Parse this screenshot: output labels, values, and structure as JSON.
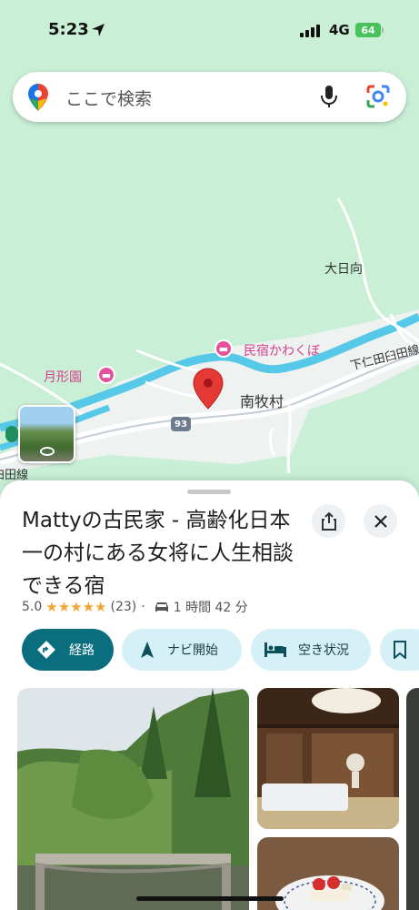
{
  "status_bar": {
    "time": "5:23",
    "network": "4G",
    "battery": "64"
  },
  "search": {
    "placeholder": "ここで検索"
  },
  "map": {
    "labels": {
      "ohinata": "大日向",
      "minamimaki": "南牧村",
      "shimonita_line_right": "下仁田臼田線",
      "usuda_line_left": "臼田線",
      "route_number": "93"
    },
    "pois": {
      "kawakubo": "民宿かわくぼ",
      "gekkeien": "月形園"
    }
  },
  "place": {
    "title": "Mattyの古民家 - 高齢化日本一の村にある女将に人生相談できる宿",
    "rating": "5.0",
    "stars": "★★★★★",
    "review_count": "(23)",
    "separator": "·",
    "drive_time": "1 時間 42 分"
  },
  "actions": {
    "directions": "経路",
    "navigate": "ナビ開始",
    "availability": "空き状況"
  },
  "colors": {
    "primary": "#0b6e7f",
    "chip_bg": "#d5f1f7",
    "star": "#f3a533",
    "map_green": "#c9efd6",
    "river": "#56c8e8",
    "poi_pink": "#e5519b",
    "pin_red": "#e53935"
  }
}
